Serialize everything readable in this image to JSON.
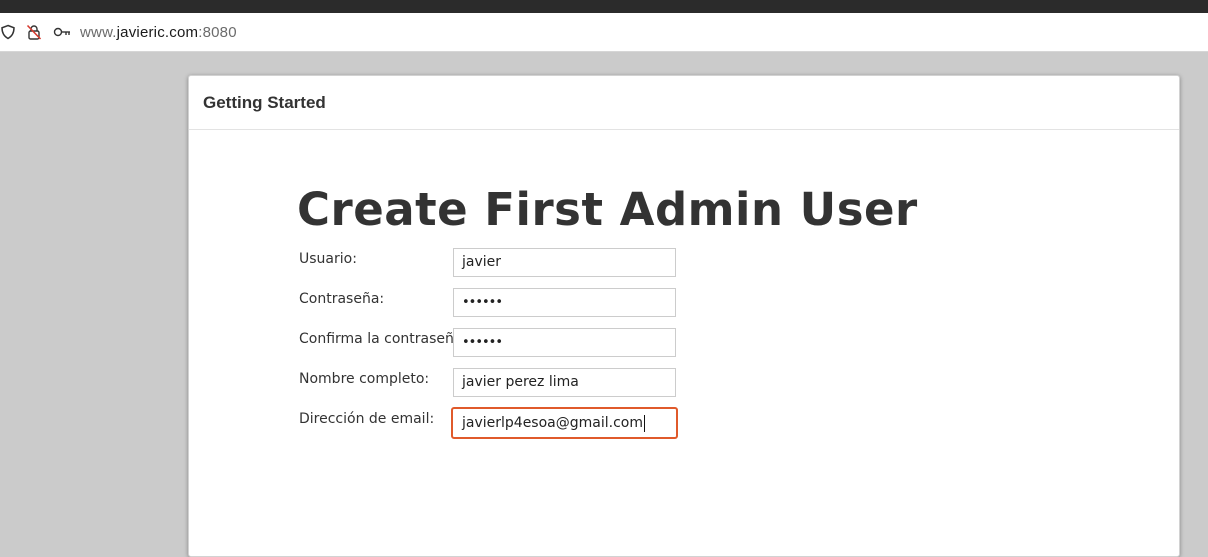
{
  "browser": {
    "url_prefix": "www.",
    "url_host": "javieric.com",
    "url_port": ":8080",
    "icons": [
      "shield-icon",
      "lock-blocked-icon",
      "key-icon"
    ]
  },
  "card": {
    "header": "Getting Started",
    "title": "Create First Admin User"
  },
  "form": {
    "usuario": {
      "label": "Usuario:",
      "value": "javier"
    },
    "password": {
      "label": "Contraseña:",
      "value": "••••••"
    },
    "confirm": {
      "label": "Confirma la contraseña:",
      "value": "••••••"
    },
    "fullname": {
      "label": "Nombre completo:",
      "value": "javier perez lima"
    },
    "email": {
      "label": "Dirección de email:",
      "value": "javierlp4esoa@gmail.com"
    }
  },
  "colors": {
    "focus_border": "#e05a2b",
    "page_bg": "#cbcbcb"
  }
}
